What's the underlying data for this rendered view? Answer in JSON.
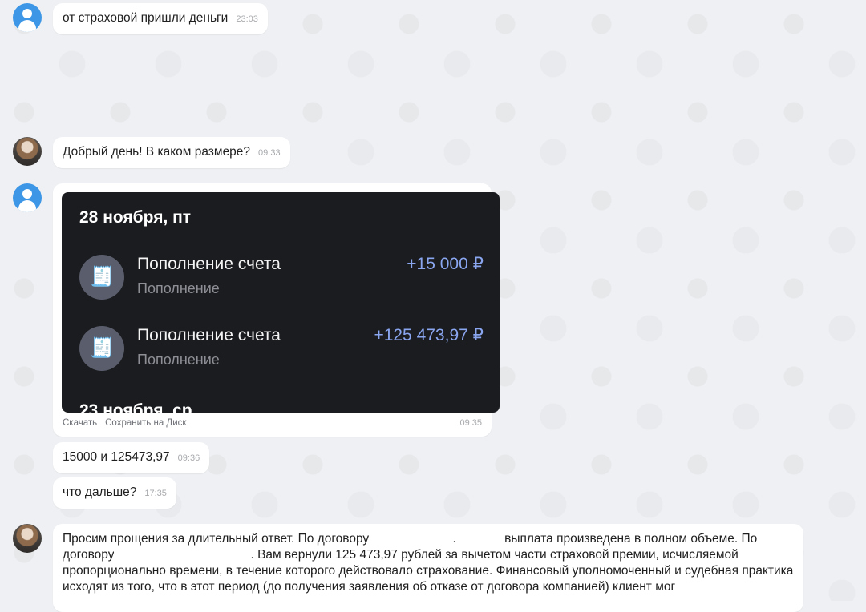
{
  "messages": {
    "m1": {
      "text": "от страховой пришли деньги",
      "time": "23:03"
    },
    "m2": {
      "text": "Добрый день! В каком размере?",
      "time": "09:33"
    },
    "m3": {
      "card": {
        "date": "28 ноября, пт",
        "transactions": [
          {
            "title": "Пополнение счета",
            "subtitle": "Пополнение",
            "amount": "+15 000 ₽",
            "icon": "receipt-icon"
          },
          {
            "title": "Пополнение счета",
            "subtitle": "Пополнение",
            "amount": "+125 473,97 ₽",
            "icon": "receipt-icon"
          }
        ],
        "next_date_cut": "23 ноября, ср"
      },
      "download_label": "Скачать",
      "save_label": "Сохранить на Диск",
      "time": "09:35"
    },
    "m4": {
      "text": "15000 и 125473,97",
      "time": "09:36"
    },
    "m5": {
      "text": "что дальше?",
      "time": "17:35"
    },
    "m6": {
      "part1": "Просим прощения за длительный ответ. По договору ",
      "part2": ".",
      "part3": " выплата произведена в полном объеме. По договору",
      "part4": ". Вам вернули 125 473,97 рублей за вычетом части страховой премии, исчисляемой пропорционально времени, в течение которого действовало страхование. Финансовый уполномоченный и судебная практика исходят из того, что в этот период (до получения заявления об отказе от договора компанией) клиент мог"
    }
  },
  "colors": {
    "background": "#eef0f3",
    "bubble": "#ffffff",
    "card": "#1b1c20",
    "amount": "#8aa6f0",
    "avatar": "#3d97e6"
  }
}
